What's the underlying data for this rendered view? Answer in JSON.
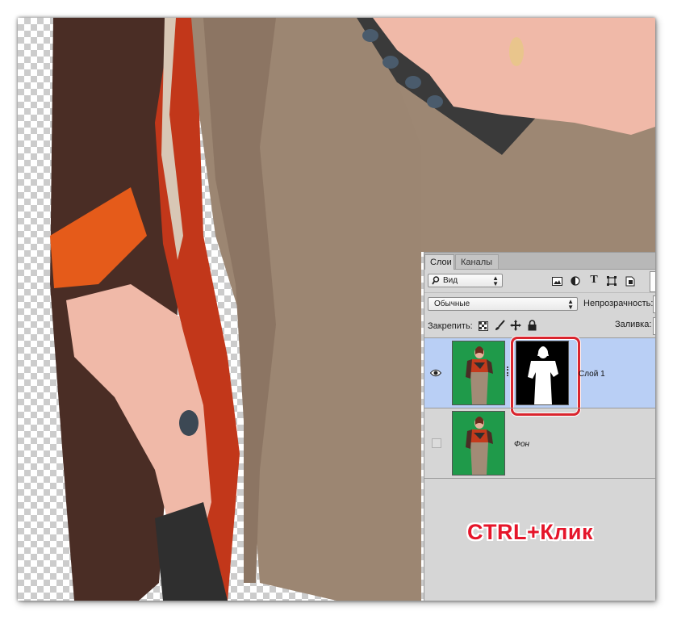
{
  "layers_panel": {
    "tabs": [
      {
        "label": "Слои",
        "active": true
      },
      {
        "label": "Каналы",
        "active": false
      }
    ],
    "filter_kind": "Вид",
    "blend_mode": "Обычные",
    "opacity_label": "Непрозрачность:",
    "lock_label": "Закрепить:",
    "fill_label": "Заливка:",
    "filter_icons": [
      "image-filter-icon",
      "adjustment-filter-icon",
      "type-filter-icon",
      "shape-filter-icon",
      "smart-object-filter-icon"
    ],
    "lock_icons": [
      "lock-transparency-icon",
      "lock-pixels-icon",
      "lock-position-icon",
      "lock-all-icon"
    ],
    "layers": [
      {
        "name": "Слой 1",
        "visible": true,
        "selected": true,
        "has_mask": true
      },
      {
        "name": "Фон",
        "visible": false,
        "selected": false,
        "has_mask": false
      }
    ]
  },
  "annotation": {
    "text": "CTRL+Клик",
    "color": "#e5152a",
    "highlight_color": "#d9252e"
  },
  "colors": {
    "selection_highlight": "#b9cff5",
    "panel_bg": "#d6d6d6",
    "thumbnail_green": "#1f9a4a"
  }
}
